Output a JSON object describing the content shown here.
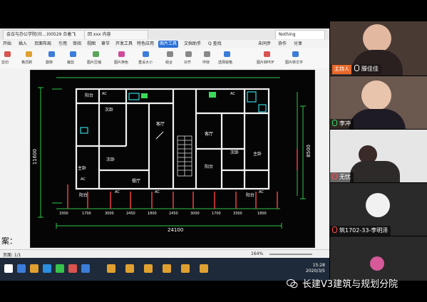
{
  "browser": {
    "tabs": [
      "会议与办公学院(社...)00529 合着飞",
      "回 xxx 内容",
      "Nothing"
    ]
  },
  "ribbon": {
    "menu": [
      "开始",
      "插入",
      "页面布局",
      "引用",
      "审阅",
      "视图",
      "章节",
      "开发工具",
      "特色应用",
      "图片工具",
      "文档助手",
      "Q 查找"
    ],
    "active_menu": "图片工具",
    "right_items": [
      "未同步",
      "协作",
      "分享"
    ],
    "tools": [
      "剪切",
      "格式刷",
      "旋转",
      "裁剪",
      "图片压缩",
      "图片换色",
      "重设大小",
      "组合",
      "对齐",
      "环绕",
      "选择窗格",
      "图片转PDF",
      "图片转文字"
    ]
  },
  "plan": {
    "rooms": [
      "阳台",
      "次卧",
      "客厅",
      "次卧",
      "主卧",
      "阳台",
      "餐厅",
      "客厅",
      "阳台",
      "次卧",
      "主卧",
      "阳台",
      "AC",
      "AC",
      "AC",
      "AC",
      "AC",
      "AC"
    ],
    "dimensions": {
      "total_width": "24100",
      "left_height": "11600",
      "right_height": "8500",
      "bottom_segments": [
        "3300",
        "1700",
        "3000",
        "2450",
        "1800",
        "2450",
        "3000",
        "1700",
        "3300",
        "1800"
      ]
    }
  },
  "document": {
    "side_text": "案："
  },
  "statusbar": {
    "page": "页面: 1/1",
    "zoom": "164%"
  },
  "taskbar": {
    "time": "15:28",
    "date": "2020/3/5"
  },
  "participants": [
    {
      "name": "滕佳佳",
      "role": "主持人",
      "mic": "on"
    },
    {
      "name": "李冲",
      "role": "",
      "mic": "green"
    },
    {
      "name": "无忧",
      "role": "",
      "mic": "muted"
    },
    {
      "name": "筑1702-33-李明泽",
      "role": "",
      "mic": "muted"
    },
    {
      "name": "",
      "role": "",
      "mic": "none"
    }
  ],
  "watermark": {
    "text": "长建V3建筑与规划分院"
  }
}
